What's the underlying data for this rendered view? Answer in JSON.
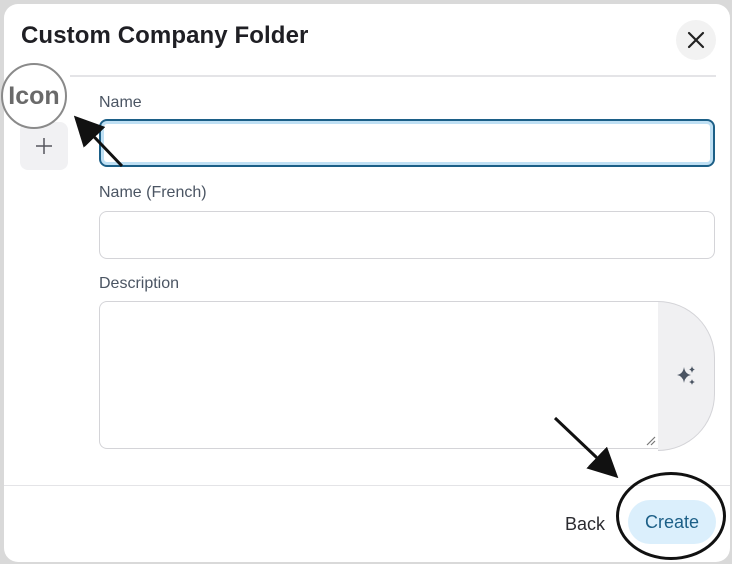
{
  "dialog": {
    "title": "Custom Company Folder",
    "close_icon": "close-icon"
  },
  "icon_picker": {
    "callout_label": "Icon",
    "icon": "plus-icon"
  },
  "fields": {
    "name": {
      "label": "Name",
      "value": "",
      "placeholder": ""
    },
    "name_french": {
      "label": "Name (French)",
      "value": "",
      "placeholder": ""
    },
    "description": {
      "label": "Description",
      "value": "",
      "placeholder": "",
      "ai_icon": "sparkles-icon"
    }
  },
  "footer": {
    "back_label": "Back",
    "create_label": "Create"
  },
  "colors": {
    "accent": "#1c5f87",
    "create_bg": "#dbeffc",
    "focus_ring": "#bfe0f4"
  }
}
